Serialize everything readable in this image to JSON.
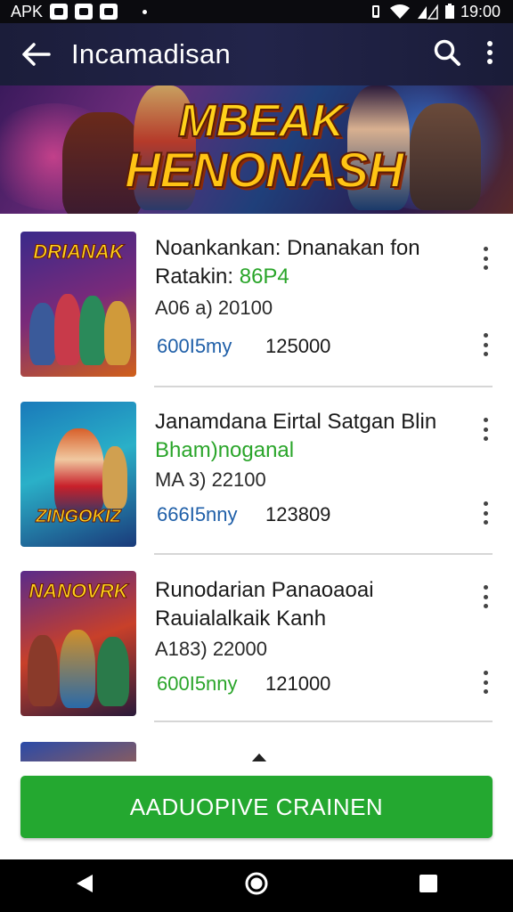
{
  "status_bar": {
    "left_text": "APK",
    "time": "19:00"
  },
  "app_bar": {
    "title": "Incamadisan"
  },
  "banner": {
    "title_line1": "MBEAK",
    "title_line2": "HENONASH"
  },
  "items": [
    {
      "thumb_label": "DRIANAK",
      "title": "Noankankan: Dnanakan fon",
      "subtitle_prefix": "Ratakin: ",
      "subtitle_accent": "86P4",
      "meta": "A06 a) 20100",
      "price": "600I5my",
      "price_color": "#1f5fa8",
      "count": "125000"
    },
    {
      "thumb_label": "ZINGOKIZ",
      "title": "Janamdana Eirtal Satgan Blin",
      "subtitle_prefix": "",
      "subtitle_accent": "Bham)noganal",
      "meta": "MA 3) 22100",
      "price": "666I5nny",
      "price_color": "#1f5fa8",
      "count": "123809"
    },
    {
      "thumb_label": "NANOVRK",
      "title": "Runodarian Panaoaoai",
      "subtitle_prefix": "Rauialalkaik Kanh",
      "subtitle_accent": "",
      "meta": "A183) 22000",
      "price": "600I5nny",
      "price_color": "#2aa52a",
      "count": "121000"
    }
  ],
  "cta": {
    "label": "AADUOPIVE CRAINEN"
  },
  "colors": {
    "accent_green": "#24a830",
    "app_bar": "#1f2142"
  }
}
